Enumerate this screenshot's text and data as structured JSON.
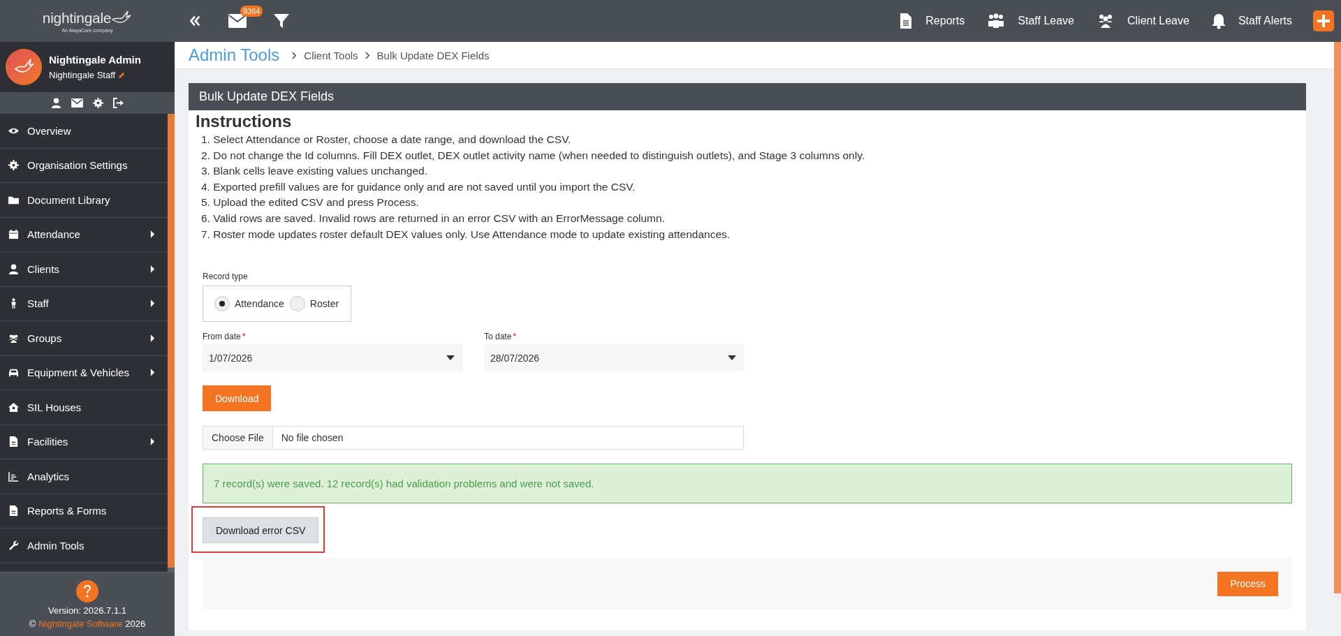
{
  "header": {
    "logo": {
      "name": "nightingale",
      "tagline": "An AlayaCare company"
    },
    "mail_badge": "9364",
    "links": [
      {
        "label": "Reports"
      },
      {
        "label": "Staff Leave"
      },
      {
        "label": "Client Leave"
      },
      {
        "label": "Staff Alerts"
      }
    ]
  },
  "user": {
    "name": "Nightingale Admin",
    "role": "Nightingale Staff"
  },
  "sidebar": {
    "items": [
      {
        "label": "Overview",
        "kind": "link"
      },
      {
        "label": "Organisation Settings",
        "kind": "link"
      },
      {
        "label": "Document Library",
        "kind": "link"
      },
      {
        "label": "Attendance",
        "kind": "submenu"
      },
      {
        "label": "Clients",
        "kind": "submenu"
      },
      {
        "label": "Staff",
        "kind": "submenu"
      },
      {
        "label": "Groups",
        "kind": "submenu"
      },
      {
        "label": "Equipment & Vehicles",
        "kind": "submenu"
      },
      {
        "label": "SIL Houses",
        "kind": "link"
      },
      {
        "label": "Facilities",
        "kind": "submenu"
      },
      {
        "label": "Analytics",
        "kind": "link"
      },
      {
        "label": "Reports & Forms",
        "kind": "link"
      },
      {
        "label": "Admin Tools",
        "kind": "link"
      }
    ]
  },
  "footer": {
    "version": "Version: 2026.7.1.1",
    "copyright": "©",
    "company": "Nightingale Software",
    "year": "2026"
  },
  "breadcrumb": {
    "title": "Admin Tools",
    "items": [
      "Client Tools",
      "Bulk Update DEX Fields"
    ]
  },
  "card": {
    "title": "Bulk Update DEX Fields",
    "instructions_heading": "Instructions",
    "instructions": [
      "1. Select Attendance or Roster, choose a date range, and download the CSV.",
      "2. Do not change the Id columns. Fill DEX outlet, DEX outlet activity name (when needed to distinguish outlets), and Stage 3 columns only.",
      "3. Blank cells leave existing values unchanged.",
      "4. Exported prefill values are for guidance only and are not saved until you import the CSV.",
      "5. Upload the edited CSV and press Process.",
      "6. Valid rows are saved. Invalid rows are returned in an error CSV with an ErrorMessage column.",
      "7. Roster mode updates roster default DEX values only. Use Attendance mode to update existing attendances."
    ]
  },
  "form": {
    "record_type": {
      "label": "Record type",
      "options": [
        {
          "label": "Attendance",
          "selected": true
        },
        {
          "label": "Roster",
          "selected": false
        }
      ]
    },
    "dates": [
      {
        "label": "From date",
        "required_mark": "*",
        "value": "1/07/2026"
      },
      {
        "label": "To date",
        "required_mark": "*",
        "value": "28/07/2026"
      }
    ],
    "download_button": "Download",
    "file": {
      "button": "Choose File",
      "status": "No file chosen"
    },
    "alert": "7 record(s) were saved. 12 record(s) had validation problems and were not saved.",
    "error_button": "Download error CSV",
    "error_button_highlighted": true,
    "process_button": "Process"
  }
}
